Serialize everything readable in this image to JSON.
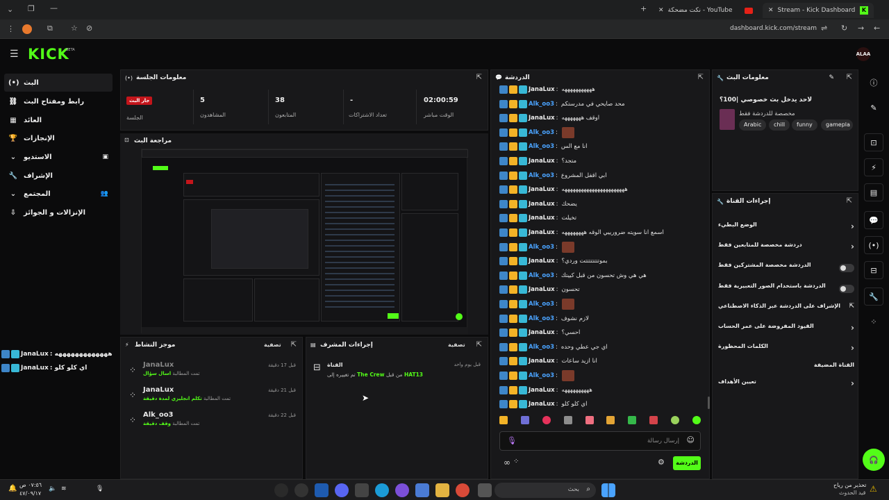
{
  "browser": {
    "tabs": [
      {
        "title": "Stream - Kick Dashboard",
        "active": true
      },
      {
        "title": "نكت مضحكة - YouTube",
        "active": false
      }
    ],
    "url": "dashboard.kick.com/stream"
  },
  "header": {
    "logo": "KICK",
    "beta": "BETA",
    "avatar": "ALAA"
  },
  "sidebar": {
    "items": [
      {
        "label": "البث",
        "icon": "(•)"
      },
      {
        "label": "رابط ومفتاح البث",
        "icon": "⛓"
      },
      {
        "label": "العائد",
        "icon": "▦"
      },
      {
        "label": "الإنجازات",
        "icon": "🏆"
      },
      {
        "label": "الاستديو",
        "icon": "▣"
      },
      {
        "label": "الإشراف",
        "icon": "🔧"
      },
      {
        "label": "المجتمع",
        "icon": "👥"
      },
      {
        "label": "الإنزالات و الجوائز",
        "icon": "⇩"
      }
    ]
  },
  "session": {
    "title": "معلومات الجلسة",
    "badge": "جار البث",
    "session_label": "الجلسة",
    "viewers_value": "5",
    "viewers_label": "المشاهدون",
    "followers_value": "38",
    "followers_label": "المتابعون",
    "subs_value": "-",
    "subs_label": "تعداد الاشتراكات",
    "time_value": "02:00:59",
    "time_label": "الوقت مباشر"
  },
  "preview": {
    "title": "مراجعة البث"
  },
  "activity": {
    "title": "موجز النشاط",
    "filter": "تصفية",
    "items": [
      {
        "name": "JanaLux",
        "sub_prefix": "تمت المطالبة",
        "reward": "اسال سؤال",
        "time": "قبل 17 دقيقة"
      },
      {
        "name": "JanaLux",
        "sub_prefix": "تمت المطالبة",
        "reward": "تكلم انجليزي لمدة دقيقة",
        "time": "قبل 21 دقيقة"
      },
      {
        "name": "Alk_oo3",
        "sub_prefix": "تمت المطالبة",
        "reward": "وقف دقيقة",
        "time": "قبل 22 دقيقة"
      }
    ]
  },
  "mod_actions": {
    "title": "إجراءات المشرف",
    "filter": "تصفية",
    "item_title": "القناة",
    "item_time": "قبل يوم واحد",
    "item_text_a": "HAT13",
    "item_text_b": "من قبل",
    "item_text_c": "The Crew",
    "item_text_d": "تم تغييره إلى"
  },
  "chat": {
    "title": "الدردشة",
    "messages": [
      {
        "user": "JanaLux",
        "text": "هههههههههههه"
      },
      {
        "user": "Alk_oo3",
        "text": "محد صايحي في مدرستكم"
      },
      {
        "user": "JanaLux",
        "text": "اوقف هههههههه"
      },
      {
        "user": "Alk_oo3",
        "text": "",
        "emote": true
      },
      {
        "user": "Alk_oo3",
        "text": "انا مع الس"
      },
      {
        "user": "JanaLux",
        "text": "متجد؟"
      },
      {
        "user": "Alk_oo3",
        "text": "ابي اقفل المشروع"
      },
      {
        "user": "JanaLux",
        "text": "هههههههههههههههههههههههه"
      },
      {
        "user": "JanaLux",
        "text": "يضحك"
      },
      {
        "user": "JanaLux",
        "text": "تخيلت"
      },
      {
        "user": "JanaLux",
        "text": "اسمع انا سويته ضرورييي الوقه ههههههههه"
      },
      {
        "user": "Alk_oo3",
        "text": "",
        "emote": true
      },
      {
        "user": "JanaLux",
        "text": "بموتتتتتتتتت وردي؟"
      },
      {
        "user": "Alk_oo3",
        "text": "هي هي وش تحسون من قبل كييتك"
      },
      {
        "user": "JanaLux",
        "text": "تحسون"
      },
      {
        "user": "Alk_oo3",
        "text": "",
        "emote": true
      },
      {
        "user": "Alk_oo3",
        "text": "لازم نشوف"
      },
      {
        "user": "JanaLux",
        "text": "احسي؟"
      },
      {
        "user": "Alk_oo3",
        "text": "اي جي عطي وحده"
      },
      {
        "user": "JanaLux",
        "text": "انا ازيد ساعات"
      },
      {
        "user": "Alk_oo3",
        "text": "",
        "emote": true
      },
      {
        "user": "JanaLux",
        "text": "ههههههههههه"
      },
      {
        "user": "JanaLux",
        "text": "اي كلو كلو"
      }
    ],
    "input_placeholder": "إرسال رسالة",
    "send_label": "الدردشة"
  },
  "stream_info": {
    "title": "معلومات البث",
    "stream_title": "لاحد يدخل بث خصوصي |100؟",
    "category": "مخصصة للدردشة فقط",
    "tags": [
      "Arabic",
      "chill",
      "funny",
      "gamepla"
    ]
  },
  "channel_actions": {
    "title": "إجراءات القناة",
    "items": [
      {
        "label": "الوضع البطيء",
        "control": "chevron"
      },
      {
        "label": "دردشة مخصصة للمتابعين فقط",
        "control": "chevron"
      },
      {
        "label": "الدردشة مخصصة المشتركين فقط",
        "control": "toggle"
      },
      {
        "label": "الدردشة باستخدام الصور التعبيرية فقط",
        "control": "toggle"
      },
      {
        "label": "الإشراف على الدردشة عبر الذكاء الاصطناعي",
        "control": "external"
      },
      {
        "label": "القيود المفروضة على عمر الحساب",
        "control": "chevron"
      },
      {
        "label": "الكلمات المحظورة",
        "control": "chevron"
      },
      {
        "label": "القناة المضيفة",
        "control": "none"
      },
      {
        "label": "تعيين الأهداف",
        "control": "chevron"
      }
    ]
  },
  "overlay_chat": [
    {
      "user": "JanaLux",
      "text": ": هههههههههههههه"
    },
    {
      "user": "JanaLux",
      "text": ": اي كلو كلو"
    }
  ],
  "taskbar": {
    "weather_line1": "تحذير من رياح",
    "weather_line2": "قيد الحدوث",
    "search_placeholder": "بحث",
    "clock_time": "٠٧:٥٦ ص",
    "clock_date": "٤٧/٠٩/١٧"
  },
  "colors": {
    "accent": "#53fc18",
    "live": "#c4151b",
    "panel": "#18181a"
  }
}
